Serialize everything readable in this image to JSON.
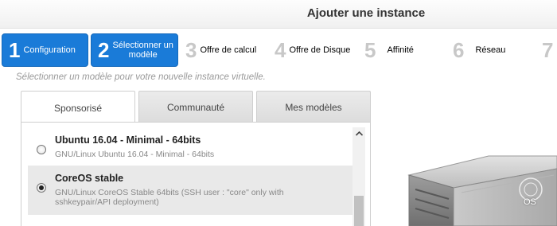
{
  "title": "Ajouter une instance",
  "steps": [
    {
      "number": "1",
      "label": "Configuration"
    },
    {
      "number": "2",
      "label_line1": "Sélectionner un",
      "label_line2": "modèle"
    },
    {
      "number": "3",
      "label": "Offre de calcul"
    },
    {
      "number": "4",
      "label": "Offre de Disque"
    },
    {
      "number": "5",
      "label": "Affinité"
    },
    {
      "number": "6",
      "label": "Réseau"
    },
    {
      "number": "7"
    }
  ],
  "subtitle": "Sélectionner un modèle pour votre nouvelle instance virtuelle.",
  "tabs": [
    {
      "label": "Sponsorisé"
    },
    {
      "label": "Communauté"
    },
    {
      "label": "Mes modèles"
    }
  ],
  "templates": [
    {
      "name": "Ubuntu 16.04 - Minimal - 64bits",
      "description": "GNU/Linux Ubuntu 16.04 - Minimal - 64bits",
      "selected": false
    },
    {
      "name": "CoreOS stable",
      "description": "GNU/Linux CoreOS Stable 64bits (SSH user : \"core\" only with sshkeypair/API deployment)",
      "selected": true
    }
  ],
  "server_label": "OS",
  "colors": {
    "accent": "#1a7bd8",
    "selected_row": "#e9e9e9"
  }
}
